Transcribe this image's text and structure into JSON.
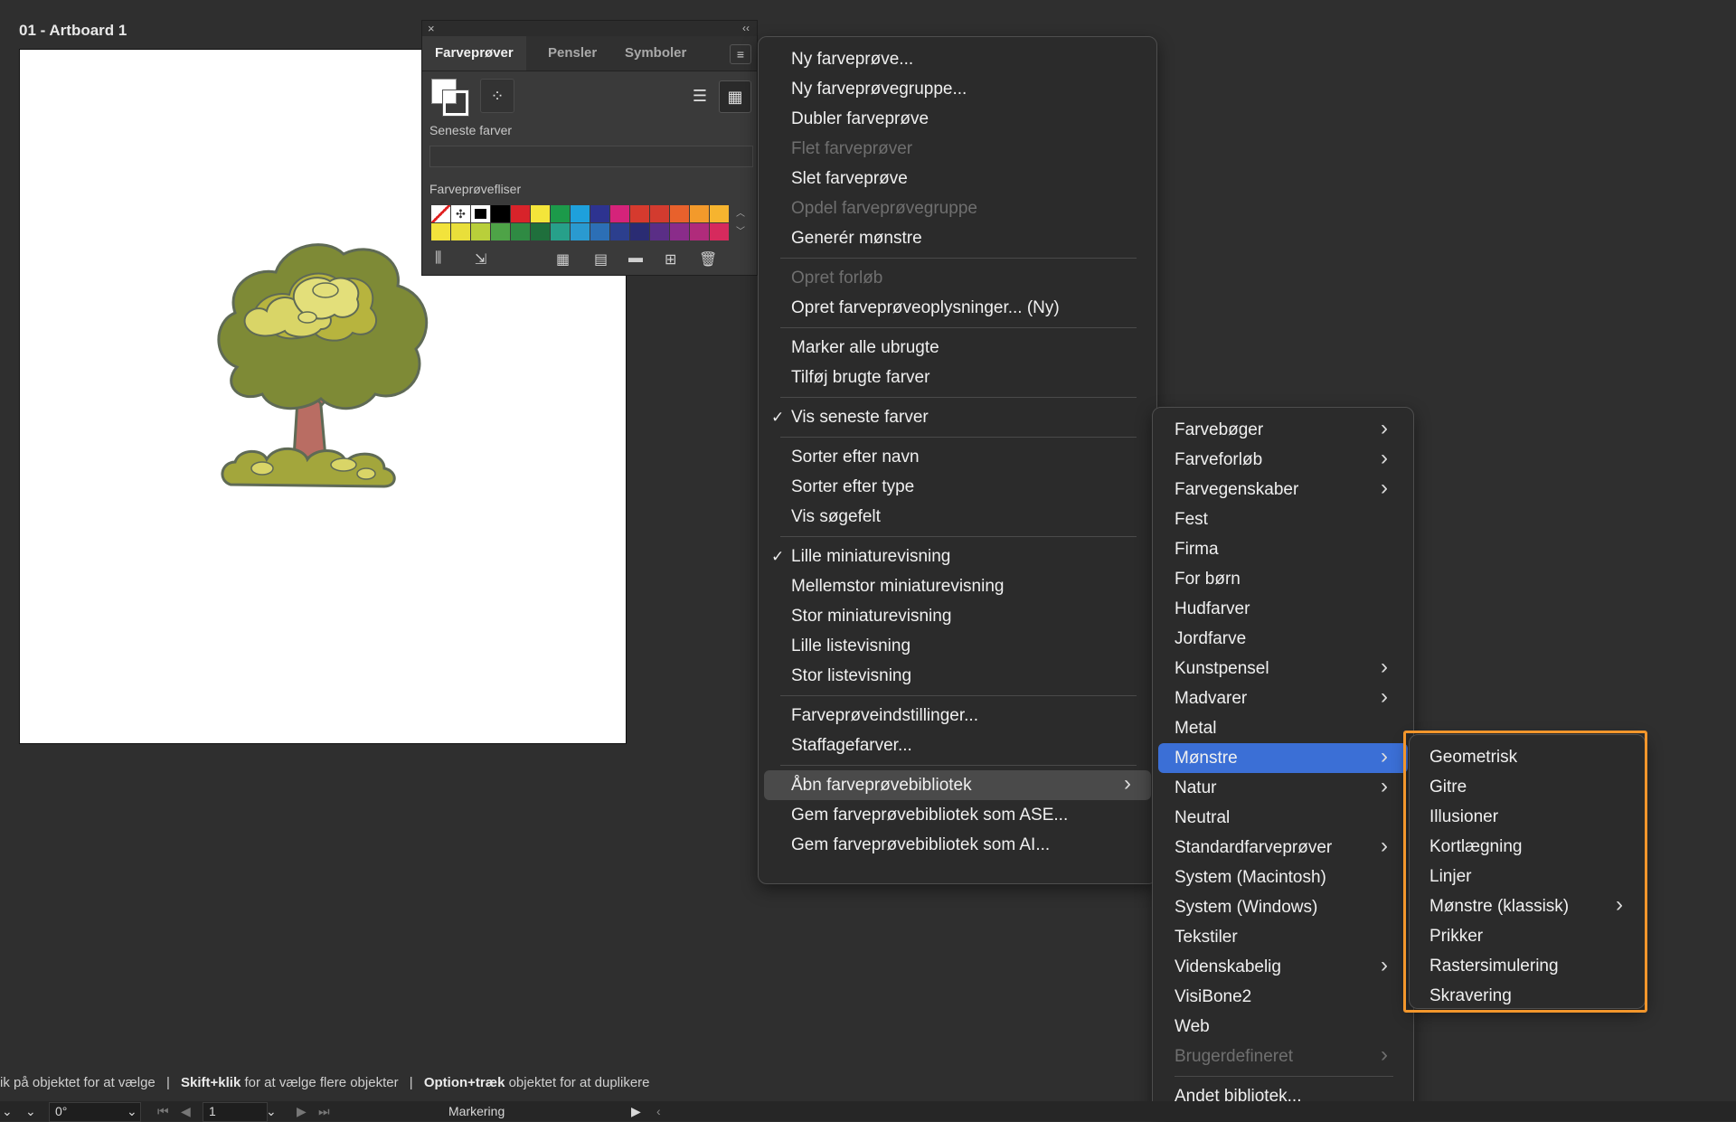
{
  "artboard": {
    "title": "01 - Artboard 1"
  },
  "swatches_panel": {
    "close": "×",
    "collapse": "‹‹",
    "tabs": [
      "Farveprøver",
      "Pensler",
      "Symboler"
    ],
    "recent_label": "Seneste farver",
    "tiles_label": "Farveprøvefliser",
    "swatch_colors": [
      "#ffffff",
      "#ffffff",
      "#ffffff",
      "#000000",
      "#d8232a",
      "#f4e53a",
      "#1c9a4a",
      "#1ea0dc",
      "#2d3390",
      "#d5237a",
      "#d63a2e",
      "#d33b2f",
      "#e8612c",
      "#f39a2b",
      "#f6b42f",
      "#f2e33c",
      "#e9df3a",
      "#b9cf3a",
      "#4ea347",
      "#2f8a43",
      "#1f6f3c",
      "#27a08a",
      "#2a9ad0",
      "#2c6fb6",
      "#2c3f8e",
      "#2a2c73",
      "#5a2e86",
      "#8a2c8a",
      "#b02b7b",
      "#d62a5d"
    ]
  },
  "main_menu": {
    "items": [
      {
        "label": "Ny farveprøve...",
        "enabled": true
      },
      {
        "label": "Ny farveprøvegruppe...",
        "enabled": true
      },
      {
        "label": "Dubler farveprøve",
        "enabled": true
      },
      {
        "label": "Flet farveprøver",
        "enabled": false
      },
      {
        "label": "Slet farveprøve",
        "enabled": true
      },
      {
        "label": "Opdel farveprøvegruppe",
        "enabled": false
      },
      {
        "label": "Generér mønstre",
        "enabled": true
      },
      {
        "label": "Opret forløb",
        "enabled": false
      },
      {
        "label": "Opret farveprøveoplysninger... (Ny)",
        "enabled": true
      },
      {
        "label": "Marker alle ubrugte",
        "enabled": true
      },
      {
        "label": "Tilføj brugte farver",
        "enabled": true
      },
      {
        "label": "Vis seneste farver",
        "enabled": true,
        "checked": true
      },
      {
        "label": "Sorter efter navn",
        "enabled": true
      },
      {
        "label": "Sorter efter type",
        "enabled": true
      },
      {
        "label": "Vis søgefelt",
        "enabled": true
      },
      {
        "label": "Lille miniaturevisning",
        "enabled": true,
        "checked": true
      },
      {
        "label": "Mellemstor miniaturevisning",
        "enabled": true
      },
      {
        "label": "Stor miniaturevisning",
        "enabled": true
      },
      {
        "label": "Lille listevisning",
        "enabled": true
      },
      {
        "label": "Stor listevisning",
        "enabled": true
      },
      {
        "label": "Farveprøveindstillinger...",
        "enabled": true
      },
      {
        "label": "Staffagefarver...",
        "enabled": true
      },
      {
        "label": "Åbn farveprøvebibliotek",
        "enabled": true,
        "submenu": true,
        "highlighted": true
      },
      {
        "label": "Gem farveprøvebibliotek som ASE...",
        "enabled": true
      },
      {
        "label": "Gem farveprøvebibliotek som AI...",
        "enabled": true
      }
    ]
  },
  "library_menu": {
    "items": [
      {
        "label": "Farvebøger",
        "submenu": true,
        "enabled": true
      },
      {
        "label": "Farveforløb",
        "submenu": true,
        "enabled": true
      },
      {
        "label": "Farvegenskaber",
        "submenu": true,
        "enabled": true
      },
      {
        "label": "Fest",
        "enabled": true
      },
      {
        "label": "Firma",
        "enabled": true
      },
      {
        "label": "For børn",
        "enabled": true
      },
      {
        "label": "Hudfarver",
        "enabled": true
      },
      {
        "label": "Jordfarve",
        "enabled": true
      },
      {
        "label": "Kunstpensel",
        "submenu": true,
        "enabled": true
      },
      {
        "label": "Madvarer",
        "submenu": true,
        "enabled": true
      },
      {
        "label": "Metal",
        "enabled": true
      },
      {
        "label": "Mønstre",
        "submenu": true,
        "enabled": true,
        "selected": true
      },
      {
        "label": "Natur",
        "submenu": true,
        "enabled": true
      },
      {
        "label": "Neutral",
        "enabled": true
      },
      {
        "label": "Standardfarveprøver",
        "submenu": true,
        "enabled": true
      },
      {
        "label": "System (Macintosh)",
        "enabled": true
      },
      {
        "label": "System (Windows)",
        "enabled": true
      },
      {
        "label": "Tekstiler",
        "enabled": true
      },
      {
        "label": "Videnskabelig",
        "submenu": true,
        "enabled": true
      },
      {
        "label": "VisiBone2",
        "enabled": true
      },
      {
        "label": "Web",
        "enabled": true
      },
      {
        "label": "Brugerdefineret",
        "submenu": true,
        "enabled": false
      },
      {
        "label": "Andet bibliotek...",
        "enabled": true
      }
    ]
  },
  "patterns_menu": {
    "items": [
      {
        "label": "Geometrisk"
      },
      {
        "label": "Gitre"
      },
      {
        "label": "Illusioner"
      },
      {
        "label": "Kortlægning"
      },
      {
        "label": "Linjer"
      },
      {
        "label": "Mønstre (klassisk)",
        "submenu": true
      },
      {
        "label": "Prikker"
      },
      {
        "label": "Rastersimulering"
      },
      {
        "label": "Skravering"
      }
    ]
  },
  "status": {
    "part1": "ik på objektet for at vælge",
    "sep": "|",
    "key2": "Skift+klik",
    "part2": "for at vælge flere objekter",
    "key3": "Option+træk",
    "part3": "objektet for at duplikere"
  },
  "bottom_bar": {
    "rotation": "0°",
    "artboard_number": "1",
    "tool_name": "Markering"
  },
  "colors": {
    "highlight": "#3b6fd6",
    "hover": "#4a4a4a",
    "callout": "#f2962c"
  }
}
